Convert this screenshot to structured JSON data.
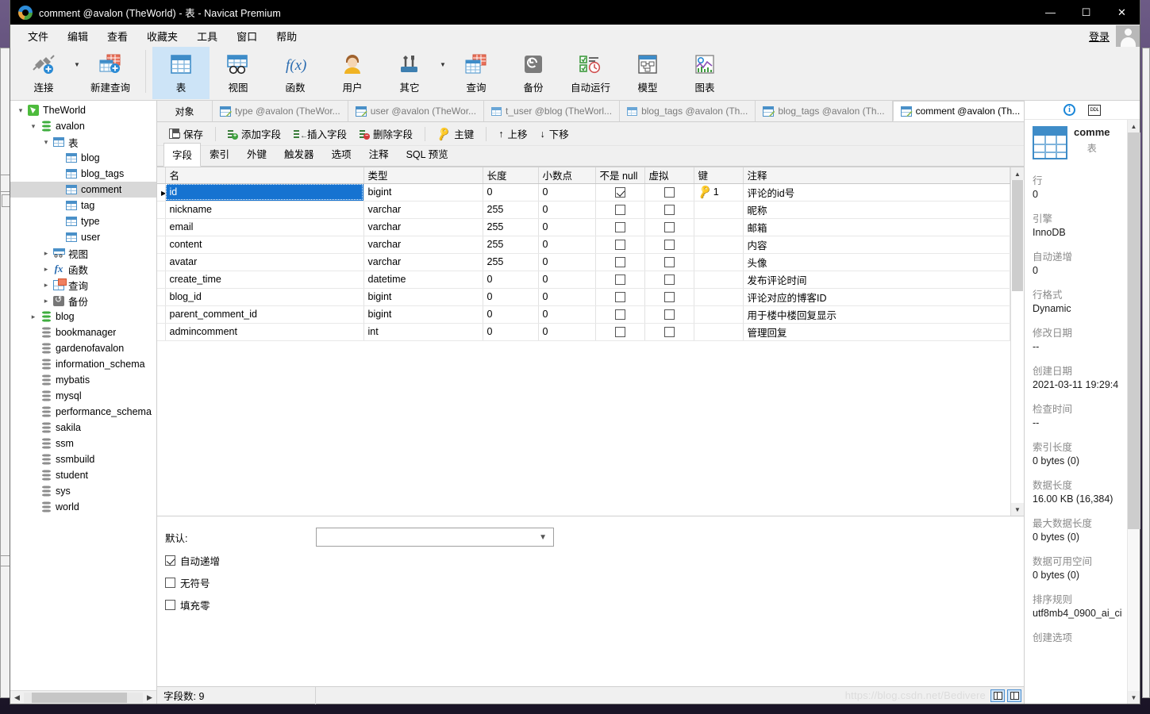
{
  "window": {
    "title": "comment @avalon (TheWorld) - 表 - Navicat Premium",
    "minimize": "—",
    "maximize": "☐",
    "close": "✕"
  },
  "menubar": {
    "items": [
      "文件",
      "编辑",
      "查看",
      "收藏夹",
      "工具",
      "窗口",
      "帮助"
    ],
    "login": "登录"
  },
  "ribbon": {
    "items": [
      {
        "label": "连接",
        "icon": "connection-icon"
      },
      {
        "label": "新建查询",
        "icon": "new-query-icon"
      },
      {
        "label": "表",
        "icon": "table-icon",
        "active": true
      },
      {
        "label": "视图",
        "icon": "view-icon"
      },
      {
        "label": "函数",
        "icon": "function-icon"
      },
      {
        "label": "用户",
        "icon": "user-icon"
      },
      {
        "label": "其它",
        "icon": "other-icon"
      },
      {
        "label": "查询",
        "icon": "query-icon"
      },
      {
        "label": "备份",
        "icon": "backup-icon"
      },
      {
        "label": "自动运行",
        "icon": "automation-icon"
      },
      {
        "label": "模型",
        "icon": "model-icon"
      },
      {
        "label": "图表",
        "icon": "chart-icon"
      }
    ]
  },
  "tree": {
    "nodes": [
      {
        "label": "TheWorld",
        "indent": 0,
        "icon": "connection-icon",
        "twisty": "v",
        "sel": false
      },
      {
        "label": "avalon",
        "indent": 1,
        "icon": "db-green-icon",
        "twisty": "v",
        "sel": false
      },
      {
        "label": "表",
        "indent": 2,
        "icon": "table-icon",
        "twisty": "v",
        "sel": false
      },
      {
        "label": "blog",
        "indent": 3,
        "icon": "table-icon",
        "twisty": "",
        "sel": false
      },
      {
        "label": "blog_tags",
        "indent": 3,
        "icon": "table-icon",
        "twisty": "",
        "sel": false
      },
      {
        "label": "comment",
        "indent": 3,
        "icon": "table-icon",
        "twisty": "",
        "sel": true
      },
      {
        "label": "tag",
        "indent": 3,
        "icon": "table-icon",
        "twisty": "",
        "sel": false
      },
      {
        "label": "type",
        "indent": 3,
        "icon": "table-icon",
        "twisty": "",
        "sel": false
      },
      {
        "label": "user",
        "indent": 3,
        "icon": "table-icon",
        "twisty": "",
        "sel": false
      },
      {
        "label": "视图",
        "indent": 2,
        "icon": "view-icon",
        "twisty": ">",
        "sel": false
      },
      {
        "label": "函数",
        "indent": 2,
        "icon": "function-icon",
        "twisty": ">",
        "sel": false
      },
      {
        "label": "查询",
        "indent": 2,
        "icon": "query-icon",
        "twisty": ">",
        "sel": false
      },
      {
        "label": "备份",
        "indent": 2,
        "icon": "backup-icon",
        "twisty": ">",
        "sel": false
      },
      {
        "label": "blog",
        "indent": 1,
        "icon": "db-green-icon",
        "twisty": ">",
        "sel": false
      },
      {
        "label": "bookmanager",
        "indent": 1,
        "icon": "db-icon",
        "twisty": "",
        "sel": false
      },
      {
        "label": "gardenofavalon",
        "indent": 1,
        "icon": "db-icon",
        "twisty": "",
        "sel": false
      },
      {
        "label": "information_schema",
        "indent": 1,
        "icon": "db-icon",
        "twisty": "",
        "sel": false
      },
      {
        "label": "mybatis",
        "indent": 1,
        "icon": "db-icon",
        "twisty": "",
        "sel": false
      },
      {
        "label": "mysql",
        "indent": 1,
        "icon": "db-icon",
        "twisty": "",
        "sel": false
      },
      {
        "label": "performance_schema",
        "indent": 1,
        "icon": "db-icon",
        "twisty": "",
        "sel": false
      },
      {
        "label": "sakila",
        "indent": 1,
        "icon": "db-icon",
        "twisty": "",
        "sel": false
      },
      {
        "label": "ssm",
        "indent": 1,
        "icon": "db-icon",
        "twisty": "",
        "sel": false
      },
      {
        "label": "ssmbuild",
        "indent": 1,
        "icon": "db-icon",
        "twisty": "",
        "sel": false
      },
      {
        "label": "student",
        "indent": 1,
        "icon": "db-icon",
        "twisty": "",
        "sel": false
      },
      {
        "label": "sys",
        "indent": 1,
        "icon": "db-icon",
        "twisty": "",
        "sel": false
      },
      {
        "label": "world",
        "indent": 1,
        "icon": "db-icon",
        "twisty": "",
        "sel": false
      }
    ]
  },
  "object_tabs": {
    "first_label": "对象",
    "tabs": [
      {
        "label": "type @avalon (TheWor...",
        "icon": "table-edit-icon",
        "active": false
      },
      {
        "label": "user @avalon (TheWor...",
        "icon": "table-edit-icon",
        "active": false
      },
      {
        "label": "t_user @blog (TheWorl...",
        "icon": "table-icon",
        "active": false
      },
      {
        "label": "blog_tags @avalon (Th...",
        "icon": "table-icon",
        "active": false
      },
      {
        "label": "blog_tags @avalon (Th...",
        "icon": "table-edit-icon",
        "active": false
      },
      {
        "label": "comment @avalon (Th...",
        "icon": "table-edit-icon",
        "active": true
      }
    ]
  },
  "table_toolbar": {
    "buttons": [
      {
        "label": "保存",
        "icon": "save-icon"
      },
      {
        "label": "添加字段",
        "icon": "add-field-icon"
      },
      {
        "label": "插入字段",
        "icon": "insert-field-icon"
      },
      {
        "label": "删除字段",
        "icon": "delete-field-icon"
      },
      {
        "label": "主键",
        "icon": "primary-key-icon"
      },
      {
        "label": "上移",
        "icon": "move-up-icon"
      },
      {
        "label": "下移",
        "icon": "move-down-icon"
      }
    ]
  },
  "field_tabs": {
    "tabs": [
      "字段",
      "索引",
      "外键",
      "触发器",
      "选项",
      "注释",
      "SQL 预览"
    ],
    "active": "字段"
  },
  "grid": {
    "columns": [
      "名",
      "类型",
      "长度",
      "小数点",
      "不是 null",
      "虚拟",
      "键",
      "注释"
    ],
    "rows": [
      {
        "name": "id",
        "type": "bigint",
        "length": "0",
        "decimals": "0",
        "notnull": true,
        "virtual": false,
        "key": "1",
        "comment": "评论的id号",
        "selected": true
      },
      {
        "name": "nickname",
        "type": "varchar",
        "length": "255",
        "decimals": "0",
        "notnull": false,
        "virtual": false,
        "key": "",
        "comment": "昵称",
        "selected": false
      },
      {
        "name": "email",
        "type": "varchar",
        "length": "255",
        "decimals": "0",
        "notnull": false,
        "virtual": false,
        "key": "",
        "comment": "邮箱",
        "selected": false
      },
      {
        "name": "content",
        "type": "varchar",
        "length": "255",
        "decimals": "0",
        "notnull": false,
        "virtual": false,
        "key": "",
        "comment": "内容",
        "selected": false
      },
      {
        "name": "avatar",
        "type": "varchar",
        "length": "255",
        "decimals": "0",
        "notnull": false,
        "virtual": false,
        "key": "",
        "comment": "头像",
        "selected": false
      },
      {
        "name": "create_time",
        "type": "datetime",
        "length": "0",
        "decimals": "0",
        "notnull": false,
        "virtual": false,
        "key": "",
        "comment": "发布评论时间",
        "selected": false
      },
      {
        "name": "blog_id",
        "type": "bigint",
        "length": "0",
        "decimals": "0",
        "notnull": false,
        "virtual": false,
        "key": "",
        "comment": "评论对应的博客ID",
        "selected": false
      },
      {
        "name": "parent_comment_id",
        "type": "bigint",
        "length": "0",
        "decimals": "0",
        "notnull": false,
        "virtual": false,
        "key": "",
        "comment": "用于楼中楼回复显示",
        "selected": false
      },
      {
        "name": "admincomment",
        "type": "int",
        "length": "0",
        "decimals": "0",
        "notnull": false,
        "virtual": false,
        "key": "",
        "comment": "管理回复",
        "selected": false
      }
    ]
  },
  "props": {
    "default_label": "默认:",
    "default_value": "",
    "checkboxes": [
      {
        "label": "自动递增",
        "checked": true
      },
      {
        "label": "无符号",
        "checked": false
      },
      {
        "label": "填充零",
        "checked": false
      }
    ]
  },
  "statusbar": {
    "field_count": "字段数: 9",
    "watermark": "https://blog.csdn.net/Bedivere"
  },
  "info_panel": {
    "table_name": "comme",
    "table_kind": "表",
    "properties": [
      {
        "key": "行",
        "value": "0"
      },
      {
        "key": "引擎",
        "value": "InnoDB"
      },
      {
        "key": "自动递增",
        "value": "0"
      },
      {
        "key": "行格式",
        "value": "Dynamic"
      },
      {
        "key": "修改日期",
        "value": "--"
      },
      {
        "key": "创建日期",
        "value": "2021-03-11 19:29:4"
      },
      {
        "key": "检查时间",
        "value": "--"
      },
      {
        "key": "索引长度",
        "value": "0 bytes (0)"
      },
      {
        "key": "数据长度",
        "value": "16.00 KB (16,384)"
      },
      {
        "key": "最大数据长度",
        "value": "0 bytes (0)"
      },
      {
        "key": "数据可用空间",
        "value": "0 bytes (0)"
      },
      {
        "key": "排序规则",
        "value": "utf8mb4_0900_ai_ci"
      },
      {
        "key": "创建选项",
        "value": ""
      }
    ]
  },
  "colors": {
    "accent": "#1673d1",
    "ribbon_active": "#cde4f7",
    "title_bg": "#000000"
  }
}
